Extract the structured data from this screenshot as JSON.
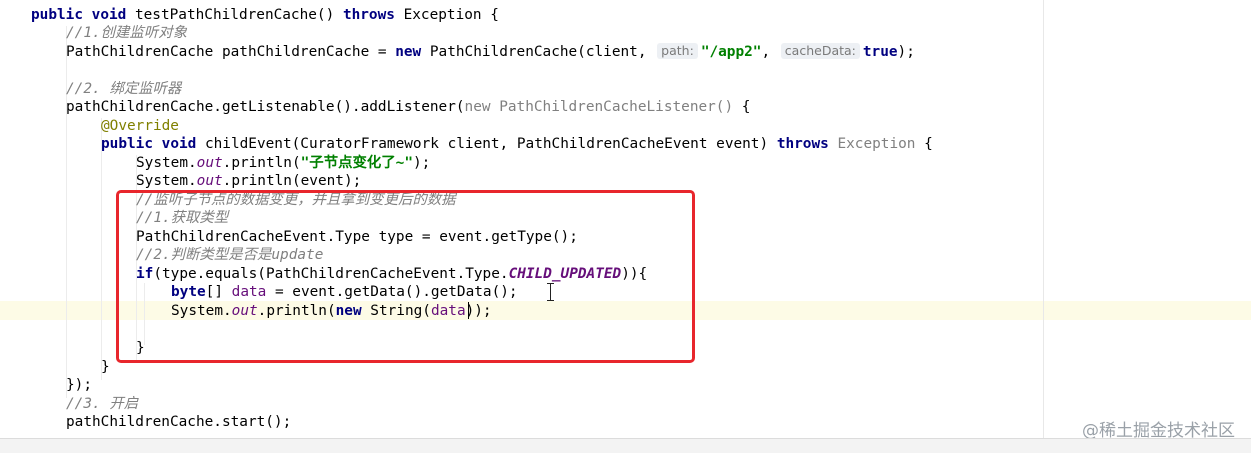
{
  "code": {
    "l1": {
      "kw1": "public",
      "kw2": "void",
      "name": "testPathChildrenCache()",
      "kw3": "throws",
      "rest": "Exception {"
    },
    "l2": {
      "comment": "//1.创建监听对象"
    },
    "l3": {
      "pre": "PathChildrenCache pathChildrenCache = ",
      "kw": "new",
      "mid": " PathChildrenCache(client, ",
      "hint1": "path:",
      "str": "\"/app2\"",
      "comma": ", ",
      "hint2": "cacheData:",
      "kw2": "true",
      "end": ");"
    },
    "l4": {
      "comment": "//2. 绑定监听器"
    },
    "l5": {
      "pre": "pathChildrenCache.getListenable().addListener(",
      "kw": "new",
      "grey": " PathChildrenCacheListener()",
      "end": " {"
    },
    "l6": {
      "annotation": "@Override"
    },
    "l7": {
      "kw1": "public",
      "kw2": "void",
      "mid": "childEvent(CuratorFramework client, PathChildrenCacheEvent event) ",
      "kw3": "throws",
      "grey": " Exception",
      "end": " {"
    },
    "l8": {
      "pre": "System.",
      "field": "out",
      "mid": ".println(",
      "str": "\"子节点变化了~\"",
      "end": ");"
    },
    "l9": {
      "pre": "System.",
      "field": "out",
      "end": ".println(event);"
    },
    "l10": {
      "comment": "//监听子节点的数据变更，并且拿到变更后的数据"
    },
    "l11": {
      "comment": "//1.获取类型"
    },
    "l12": {
      "text": "PathChildrenCacheEvent.Type type = event.getType();"
    },
    "l13": {
      "comment": "//2.判断类型是否是update"
    },
    "l14": {
      "kw": "if",
      "pre": "(type.equals(PathChildrenCacheEvent.Type.",
      "const": "CHILD_UPDATED",
      "end": ")){"
    },
    "l15": {
      "kw": "byte",
      "mid": "[] ",
      "var": "data",
      "end": " = event.getData().getData();"
    },
    "l16": {
      "pre": "System.",
      "field": "out",
      "mid": ".println(",
      "kw": "new",
      "mid2": " String(",
      "var": "data",
      "end": "));"
    },
    "l18": {
      "text": "}"
    },
    "l19": {
      "text": "}"
    },
    "l20": {
      "text": "});"
    },
    "l21": {
      "comment": "//3. 开启"
    },
    "l22": {
      "text": "pathChildrenCache.start();"
    }
  },
  "watermark": "@稀土掘金技术社区",
  "colors": {
    "keyword": "#000080",
    "comment": "#808080",
    "string": "#008000",
    "field": "#660e7a",
    "annotation": "#808000",
    "highlight_box": "#e8262c",
    "current_line": "#fdfbe6"
  }
}
